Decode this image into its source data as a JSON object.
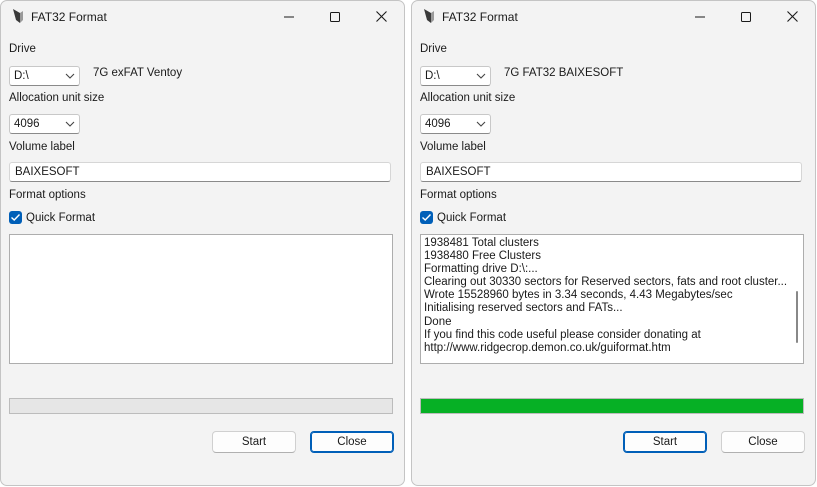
{
  "colors": {
    "accent": "#005fb8",
    "progress_fill": "#06b025"
  },
  "windows": [
    {
      "title": "FAT32 Format",
      "drive_label": "Drive",
      "drive_value": "D:\\",
      "drive_info": "7G exFAT Ventoy",
      "alloc_label": "Allocation unit size",
      "alloc_value": "4096",
      "volume_label_label": "Volume label",
      "volume_label_value": "BAIXESOFT",
      "format_options_label": "Format options",
      "quick_format_label": "Quick Format",
      "quick_format_checked": true,
      "log_lines": [],
      "log_scrollbar": false,
      "progress": 0,
      "start_label": "Start",
      "close_label": "Close",
      "default_button": "close"
    },
    {
      "title": "FAT32 Format",
      "drive_label": "Drive",
      "drive_value": "D:\\",
      "drive_info": "7G FAT32 BAIXESOFT",
      "alloc_label": "Allocation unit size",
      "alloc_value": "4096",
      "volume_label_label": "Volume label",
      "volume_label_value": "BAIXESOFT",
      "format_options_label": "Format options",
      "quick_format_label": "Quick Format",
      "quick_format_checked": true,
      "log_lines": [
        "1938481 Total clusters",
        "1938480 Free Clusters",
        "Formatting drive D:\\:...",
        "Clearing out 30330 sectors for Reserved sectors, fats and root cluster...",
        "Wrote 15528960 bytes in 3.34 seconds, 4.43 Megabytes/sec",
        "Initialising reserved sectors and FATs...",
        "Done",
        "If you find this code useful please consider donating at",
        "http://www.ridgecrop.demon.co.uk/guiformat.htm"
      ],
      "log_scrollbar": true,
      "progress": 1.0,
      "start_label": "Start",
      "close_label": "Close",
      "default_button": "start"
    }
  ]
}
